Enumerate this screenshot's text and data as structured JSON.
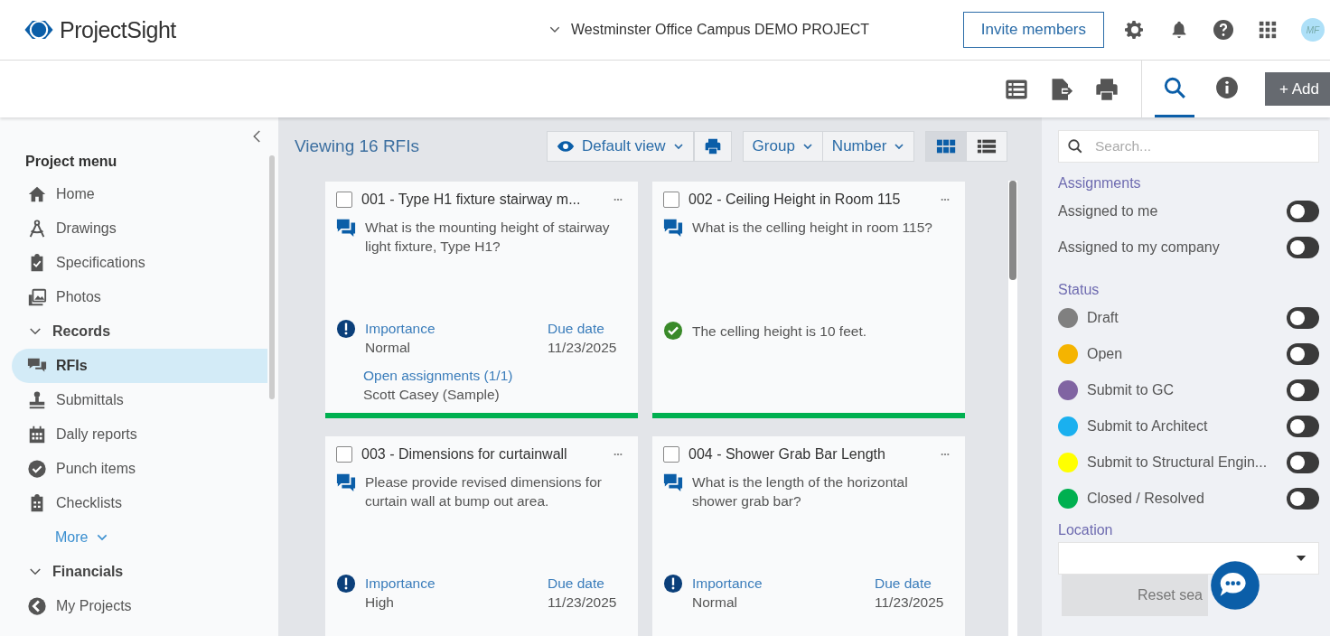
{
  "header": {
    "logo": "ProjectSight",
    "project": "Westminster Office Campus DEMO PROJECT",
    "invite_button": "Invite members",
    "avatar": "MF"
  },
  "toolbar": {
    "panel_tabs": [
      {
        "selected": true
      },
      {
        "selected": false
      }
    ],
    "add_button": "+ Add"
  },
  "sidebar": {
    "title": "Project menu",
    "items": [
      {
        "kind": "item",
        "label": "Home",
        "selected": false
      },
      {
        "kind": "item",
        "label": "Drawings",
        "selected": false
      },
      {
        "kind": "item",
        "label": "Specifications",
        "selected": false
      },
      {
        "kind": "item",
        "label": "Photos",
        "selected": false
      },
      {
        "kind": "group",
        "label": "Records",
        "expanded": true
      },
      {
        "kind": "item",
        "label": "RFIs",
        "selected": true
      },
      {
        "kind": "item",
        "label": "Submittals",
        "selected": false
      },
      {
        "kind": "item",
        "label": "Dally reports",
        "selected": false
      },
      {
        "kind": "item",
        "label": "Punch items",
        "selected": false
      },
      {
        "kind": "item",
        "label": "Checklists",
        "selected": false
      },
      {
        "kind": "more",
        "label": "More"
      },
      {
        "kind": "group",
        "label": "Financials",
        "expanded": true
      },
      {
        "kind": "item",
        "label": "My Projects",
        "selected": false
      }
    ]
  },
  "content": {
    "heading": "Viewing 16 RFIs",
    "view_button": "Default view",
    "group_button": "Group",
    "sort_button": "Number",
    "view_modes": [
      {
        "selected": true
      },
      {
        "selected": false
      }
    ],
    "cards": [
      {
        "title": "001 - Type H1 fixture stairway m...",
        "checked": false,
        "question": "What is the mounting height of stairway light fixture, Type H1?",
        "kind": "open",
        "importance_label": "Importance",
        "importance": "Normal",
        "due_label": "Due date",
        "due": "11/23/2025",
        "assignments_label": "Open assignments  (1/1)",
        "assignee": "Scott Casey (Sample)",
        "color": "#00b050"
      },
      {
        "title": "002 - Ceiling Height in Room 115",
        "checked": false,
        "question": "What is the celling height in room 115?",
        "kind": "answered",
        "answer": "The celling height is 10 feet.",
        "color": "#00b050"
      },
      {
        "title": "003 - Dimensions for curtainwall",
        "checked": false,
        "question": "Please provide revised dimensions for curtain wall at bump out area.",
        "kind": "open",
        "importance_label": "Importance",
        "importance": "High",
        "due_label": "Due date",
        "due": "11/23/2025"
      },
      {
        "title": "004 - Shower Grab Bar Length",
        "checked": false,
        "question": "What is the length of the horizontal shower grab bar?",
        "kind": "open",
        "importance_label": "Importance",
        "importance": "Normal",
        "due_label": "Due date",
        "due": "11/23/2025"
      }
    ]
  },
  "filters": {
    "search": {
      "placeholder": "Search..."
    },
    "assignments_title": "Assignments",
    "assignments": [
      {
        "label": "Assigned to me",
        "on": false
      },
      {
        "label": "Assigned to my company",
        "on": false
      }
    ],
    "status_title": "Status",
    "statuses": [
      {
        "label": "Draft",
        "color": "#808080",
        "on": false
      },
      {
        "label": "Open",
        "color": "#f5b400",
        "on": false
      },
      {
        "label": "Submit to GC",
        "color": "#8064a2",
        "on": false
      },
      {
        "label": "Submit to Architect",
        "color": "#1ab0ef",
        "on": false
      },
      {
        "label": "Submit to Structural Engin...",
        "color": "#ffff00",
        "on": false
      },
      {
        "label": "Closed / Resolved",
        "color": "#00b050",
        "on": false
      }
    ],
    "location_title": "Location",
    "reset_button": "Reset sea"
  }
}
